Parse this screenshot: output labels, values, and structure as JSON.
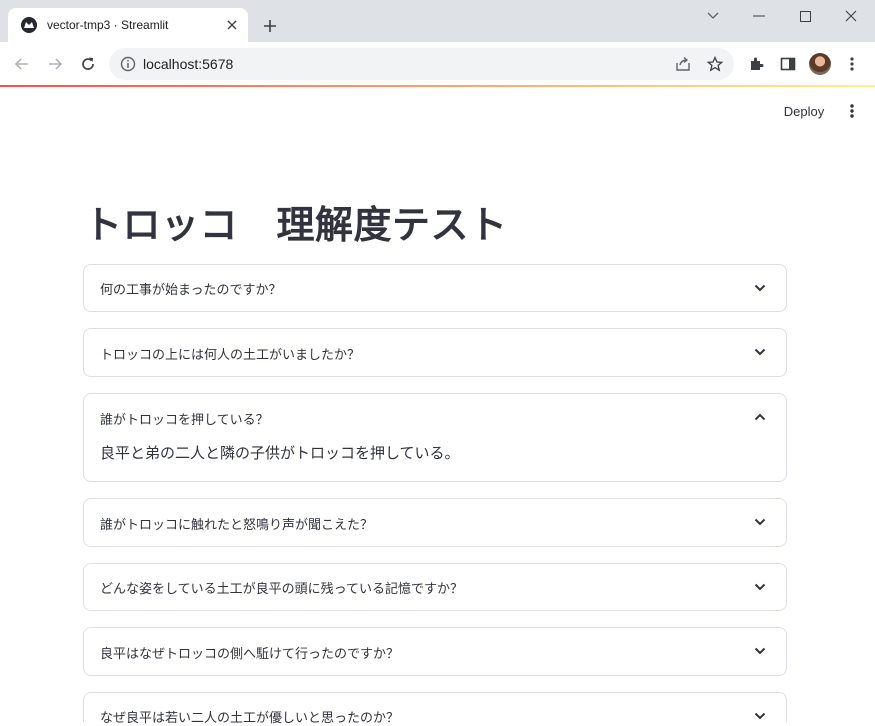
{
  "browser": {
    "tab_title": "vector-tmp3 · Streamlit",
    "url": "localhost:5678"
  },
  "app": {
    "deploy_label": "Deploy",
    "title": "トロッコ　理解度テスト",
    "accent_colors": [
      "#ff4b4b",
      "#fdf38b"
    ]
  },
  "expanders": [
    {
      "question": "何の工事が始まったのですか？",
      "expanded": false
    },
    {
      "question": "トロッコの上には何人の土工がいましたか？",
      "expanded": false
    },
    {
      "question": "誰がトロッコを押している？",
      "expanded": true,
      "answer": "良平と弟の二人と隣の子供がトロッコを押している。"
    },
    {
      "question": "誰がトロッコに触れたと怒鳴り声が聞こえた？",
      "expanded": false
    },
    {
      "question": "どんな姿をしている土工が良平の頭に残っている記憶ですか？",
      "expanded": false
    },
    {
      "question": "良平はなぜトロッコの側へ駈けて行ったのですか？",
      "expanded": false
    },
    {
      "question": "なぜ良平は若い二人の土工が優しいと思ったのか？",
      "expanded": false
    }
  ]
}
